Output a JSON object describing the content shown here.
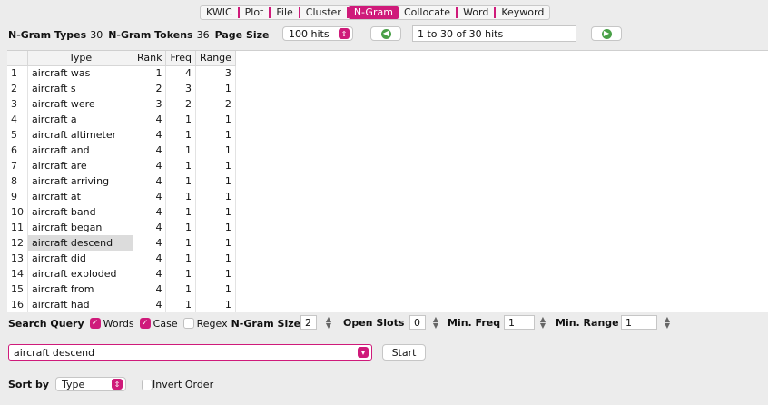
{
  "tabs": [
    "KWIC",
    "Plot",
    "File",
    "Cluster",
    "N-Gram",
    "Collocate",
    "Word",
    "Keyword"
  ],
  "active_tab": "N-Gram",
  "stats": {
    "types_label": "N-Gram Types",
    "types_value": "30",
    "tokens_label": "N-Gram Tokens",
    "tokens_value": "36",
    "page_size_label": "Page Size",
    "page_size_value": "100 hits",
    "hits_range": "1 to 30 of 30 hits"
  },
  "table": {
    "columns": [
      "Type",
      "Rank",
      "Freq",
      "Range"
    ],
    "selected_index": 11,
    "rows": [
      {
        "n": "1",
        "type": "aircraft was",
        "rank": "1",
        "freq": "4",
        "range": "3"
      },
      {
        "n": "2",
        "type": "aircraft s",
        "rank": "2",
        "freq": "3",
        "range": "1"
      },
      {
        "n": "3",
        "type": "aircraft were",
        "rank": "3",
        "freq": "2",
        "range": "2"
      },
      {
        "n": "4",
        "type": "aircraft a",
        "rank": "4",
        "freq": "1",
        "range": "1"
      },
      {
        "n": "5",
        "type": "aircraft altimeter",
        "rank": "4",
        "freq": "1",
        "range": "1"
      },
      {
        "n": "6",
        "type": "aircraft and",
        "rank": "4",
        "freq": "1",
        "range": "1"
      },
      {
        "n": "7",
        "type": "aircraft are",
        "rank": "4",
        "freq": "1",
        "range": "1"
      },
      {
        "n": "8",
        "type": "aircraft arriving",
        "rank": "4",
        "freq": "1",
        "range": "1"
      },
      {
        "n": "9",
        "type": "aircraft at",
        "rank": "4",
        "freq": "1",
        "range": "1"
      },
      {
        "n": "10",
        "type": "aircraft band",
        "rank": "4",
        "freq": "1",
        "range": "1"
      },
      {
        "n": "11",
        "type": "aircraft began",
        "rank": "4",
        "freq": "1",
        "range": "1"
      },
      {
        "n": "12",
        "type": "aircraft descend",
        "rank": "4",
        "freq": "1",
        "range": "1"
      },
      {
        "n": "13",
        "type": "aircraft did",
        "rank": "4",
        "freq": "1",
        "range": "1"
      },
      {
        "n": "14",
        "type": "aircraft exploded",
        "rank": "4",
        "freq": "1",
        "range": "1"
      },
      {
        "n": "15",
        "type": "aircraft from",
        "rank": "4",
        "freq": "1",
        "range": "1"
      },
      {
        "n": "16",
        "type": "aircraft had",
        "rank": "4",
        "freq": "1",
        "range": "1"
      }
    ]
  },
  "query_options": {
    "search_query_label": "Search Query",
    "words_label": "Words",
    "words_checked": true,
    "case_label": "Case",
    "case_checked": true,
    "regex_label": "Regex",
    "regex_checked": false,
    "ngram_size_label": "N-Gram Size",
    "ngram_size_value": "2",
    "open_slots_label": "Open Slots",
    "open_slots_value": "0",
    "min_freq_label": "Min. Freq",
    "min_freq_value": "1",
    "min_range_label": "Min. Range",
    "min_range_value": "1"
  },
  "search": {
    "query_value": "aircraft descend",
    "start_label": "Start"
  },
  "sort": {
    "label": "Sort by",
    "value": "Type",
    "invert_label": "Invert Order",
    "invert_checked": false
  },
  "colors": {
    "accent": "#cf1a7a",
    "nav_green": "#49a047"
  },
  "icons": {
    "prev": "circle-arrow-left-icon",
    "next": "circle-arrow-right-icon",
    "dropdown": "chevron-updown-icon"
  }
}
